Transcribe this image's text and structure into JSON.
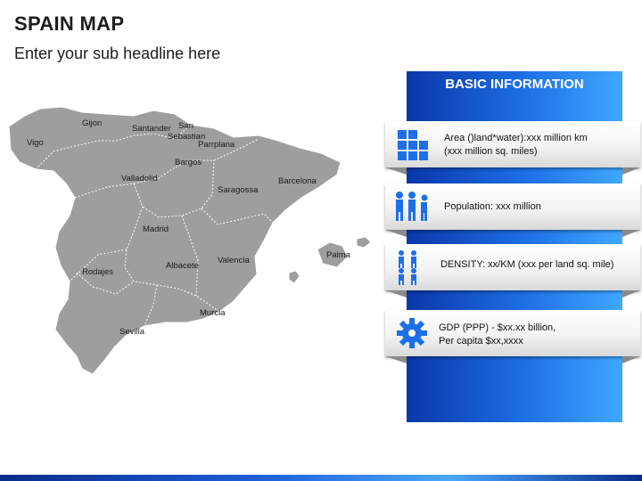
{
  "header": {
    "title": "SPAIN MAP",
    "subtitle": "Enter your sub headline here"
  },
  "map": {
    "cities": [
      {
        "name": "Gijon"
      },
      {
        "name": "Santander"
      },
      {
        "name": "San"
      },
      {
        "name": "Sebastian"
      },
      {
        "name": "Vigo"
      },
      {
        "name": "Parrplana"
      },
      {
        "name": "Bargos"
      },
      {
        "name": "Valladolid"
      },
      {
        "name": "Saragossa"
      },
      {
        "name": "Barcelona"
      },
      {
        "name": "Madrid"
      },
      {
        "name": "Albacete"
      },
      {
        "name": "Valencia"
      },
      {
        "name": "Palma"
      },
      {
        "name": "Rodajes"
      },
      {
        "name": "Murcia"
      },
      {
        "name": "Sevilla"
      }
    ]
  },
  "info": {
    "title": "BASIC INFORMATION",
    "cards": [
      {
        "icon": "grid-squares-icon",
        "line1": "Area ()land*water):xxx million km",
        "line2": "(xxx million sq. miles)"
      },
      {
        "icon": "people-group-icon",
        "line1": "Population: xxx million",
        "line2": ""
      },
      {
        "icon": "density-people-icon",
        "line1": "DENSITY: xx/KM (xxx per land sq. mile)",
        "line2": ""
      },
      {
        "icon": "gear-icon",
        "line1": "GDP (PPP) - $xx.xx billion,",
        "line2": "Per capita $xx,xxxx"
      }
    ]
  },
  "colors": {
    "accent_blue": "#1e6fe6",
    "map_gray": "#9e9e9e"
  }
}
